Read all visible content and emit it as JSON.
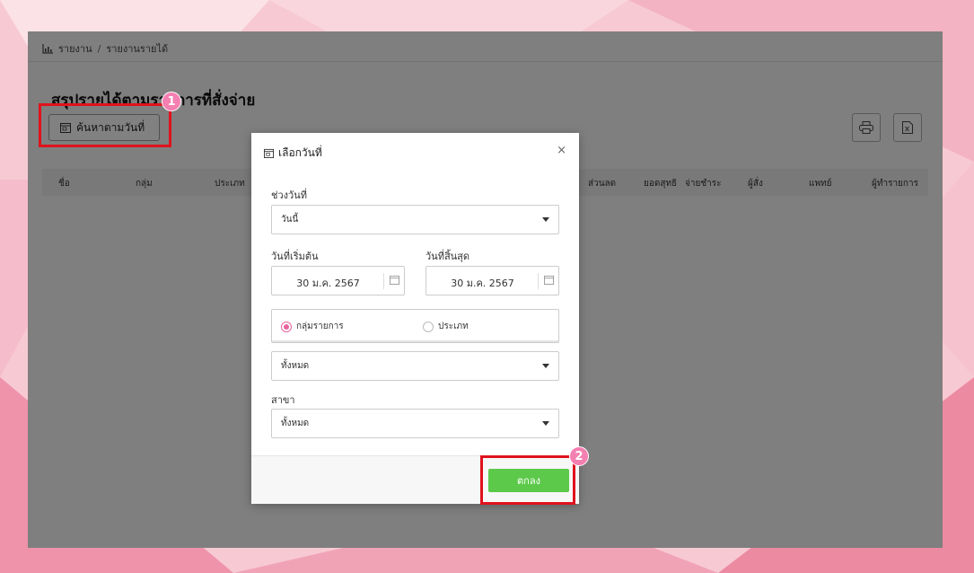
{
  "breadcrumb": {
    "icon": "bar-chart-icon",
    "items": [
      "รายงาน",
      "รายงานรายได้"
    ],
    "separator": "/"
  },
  "page": {
    "title": "สรุปรายได้ตามรายการที่สั่งจ่าย",
    "search_button_label": "ค้นหาตามวันที่"
  },
  "toolbar": {
    "print_icon": "print-icon",
    "excel_icon": "excel-export-icon"
  },
  "table": {
    "columns": [
      "ชื่อ",
      "กลุ่ม",
      "ประเภท",
      "ส่วนลด",
      "ยอดสุทธิ",
      "จ่ายชำระ",
      "ผู้สั่ง",
      "แพทย์",
      "ผู้ทำรายการ"
    ]
  },
  "modal": {
    "title": "เลือกวันที่",
    "close": "×",
    "range_label": "ช่วงวันที่",
    "range_value": "วันนี้",
    "start_label": "วันที่เริ่มต้น",
    "start_value": "30 ม.ค. 2567",
    "end_label": "วันที่สิ้นสุด",
    "end_value": "30 ม.ค. 2567",
    "radio_options": [
      {
        "label": "กลุ่มรายการ",
        "selected": true
      },
      {
        "label": "ประเภท",
        "selected": false
      }
    ],
    "group_value": "ทั้งหมด",
    "branch_label": "สาขา",
    "branch_value": "ทั้งหมด",
    "ok_label": "ตกลง"
  },
  "annotations": {
    "step1": "1",
    "step2": "2",
    "highlight_color": "#e0121c",
    "badge_color": "#f47fb1"
  },
  "colors": {
    "primary_button": "#5dc94b",
    "radio_accent": "#e7649e"
  }
}
